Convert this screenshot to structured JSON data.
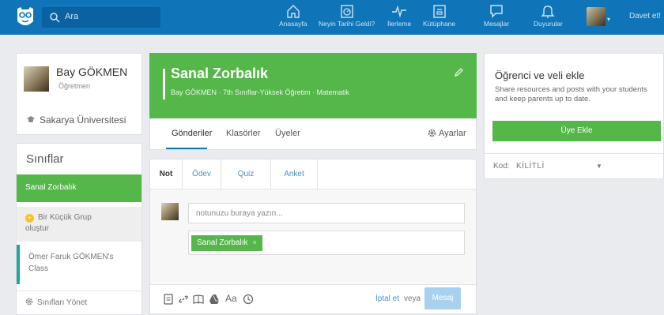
{
  "search": {
    "placeholder": "Ara"
  },
  "nav": [
    {
      "label": "Anasayfa",
      "icon": "home-icon"
    },
    {
      "label": "Neyin Tarihi Geldi?",
      "icon": "calendar-icon"
    },
    {
      "label": "İlerleme",
      "icon": "pulse-icon"
    },
    {
      "label": "Kütüphane",
      "icon": "library-icon"
    },
    {
      "label": "Mesajlar",
      "icon": "message-icon"
    },
    {
      "label": "Duyurular",
      "icon": "bell-icon"
    }
  ],
  "invite": "Davet et!",
  "profile": {
    "name": "Bay GÖKMEN",
    "role": "Öğretmen",
    "school": "Sakarya Üniversitesi"
  },
  "classes": {
    "heading": "Sınıflar",
    "active": "Sanal Zorbalık",
    "join_line1": "Bir Küçük Grup",
    "join_line2": "oluştur",
    "other_line1": "Ömer Faruk GÖKMEN's",
    "other_line2": "Class",
    "manage": "Sınıfları Yönet"
  },
  "group": {
    "title": "Sanal Zorbalık",
    "subtitle": "Bay GÖKMEN · 7th Sınıflar-Yüksek Öğretim · Matematik",
    "tabs": [
      "Gönderiler",
      "Klasörler",
      "Üyeler"
    ],
    "settings": "Ayarlar"
  },
  "composer": {
    "types": [
      "Not",
      "Ödev",
      "Quiz",
      "Anket"
    ],
    "placeholder": "notunuzu buraya yazın...",
    "recipient": "Sanal Zorbalık",
    "aa": "Aa",
    "cancel": "İptal et",
    "or": "veya",
    "send": "Mesaj"
  },
  "right": {
    "title": "Öğrenci ve veli ekle",
    "text": "Share resources and posts with your students and keep parents up to date.",
    "button": "Üye Ekle",
    "code_label": "Kod:",
    "code_value": "KİLİTLİ"
  },
  "colors": {
    "topbar": "#0f75b8",
    "green": "#55b74a",
    "teal": "#21a69b"
  }
}
